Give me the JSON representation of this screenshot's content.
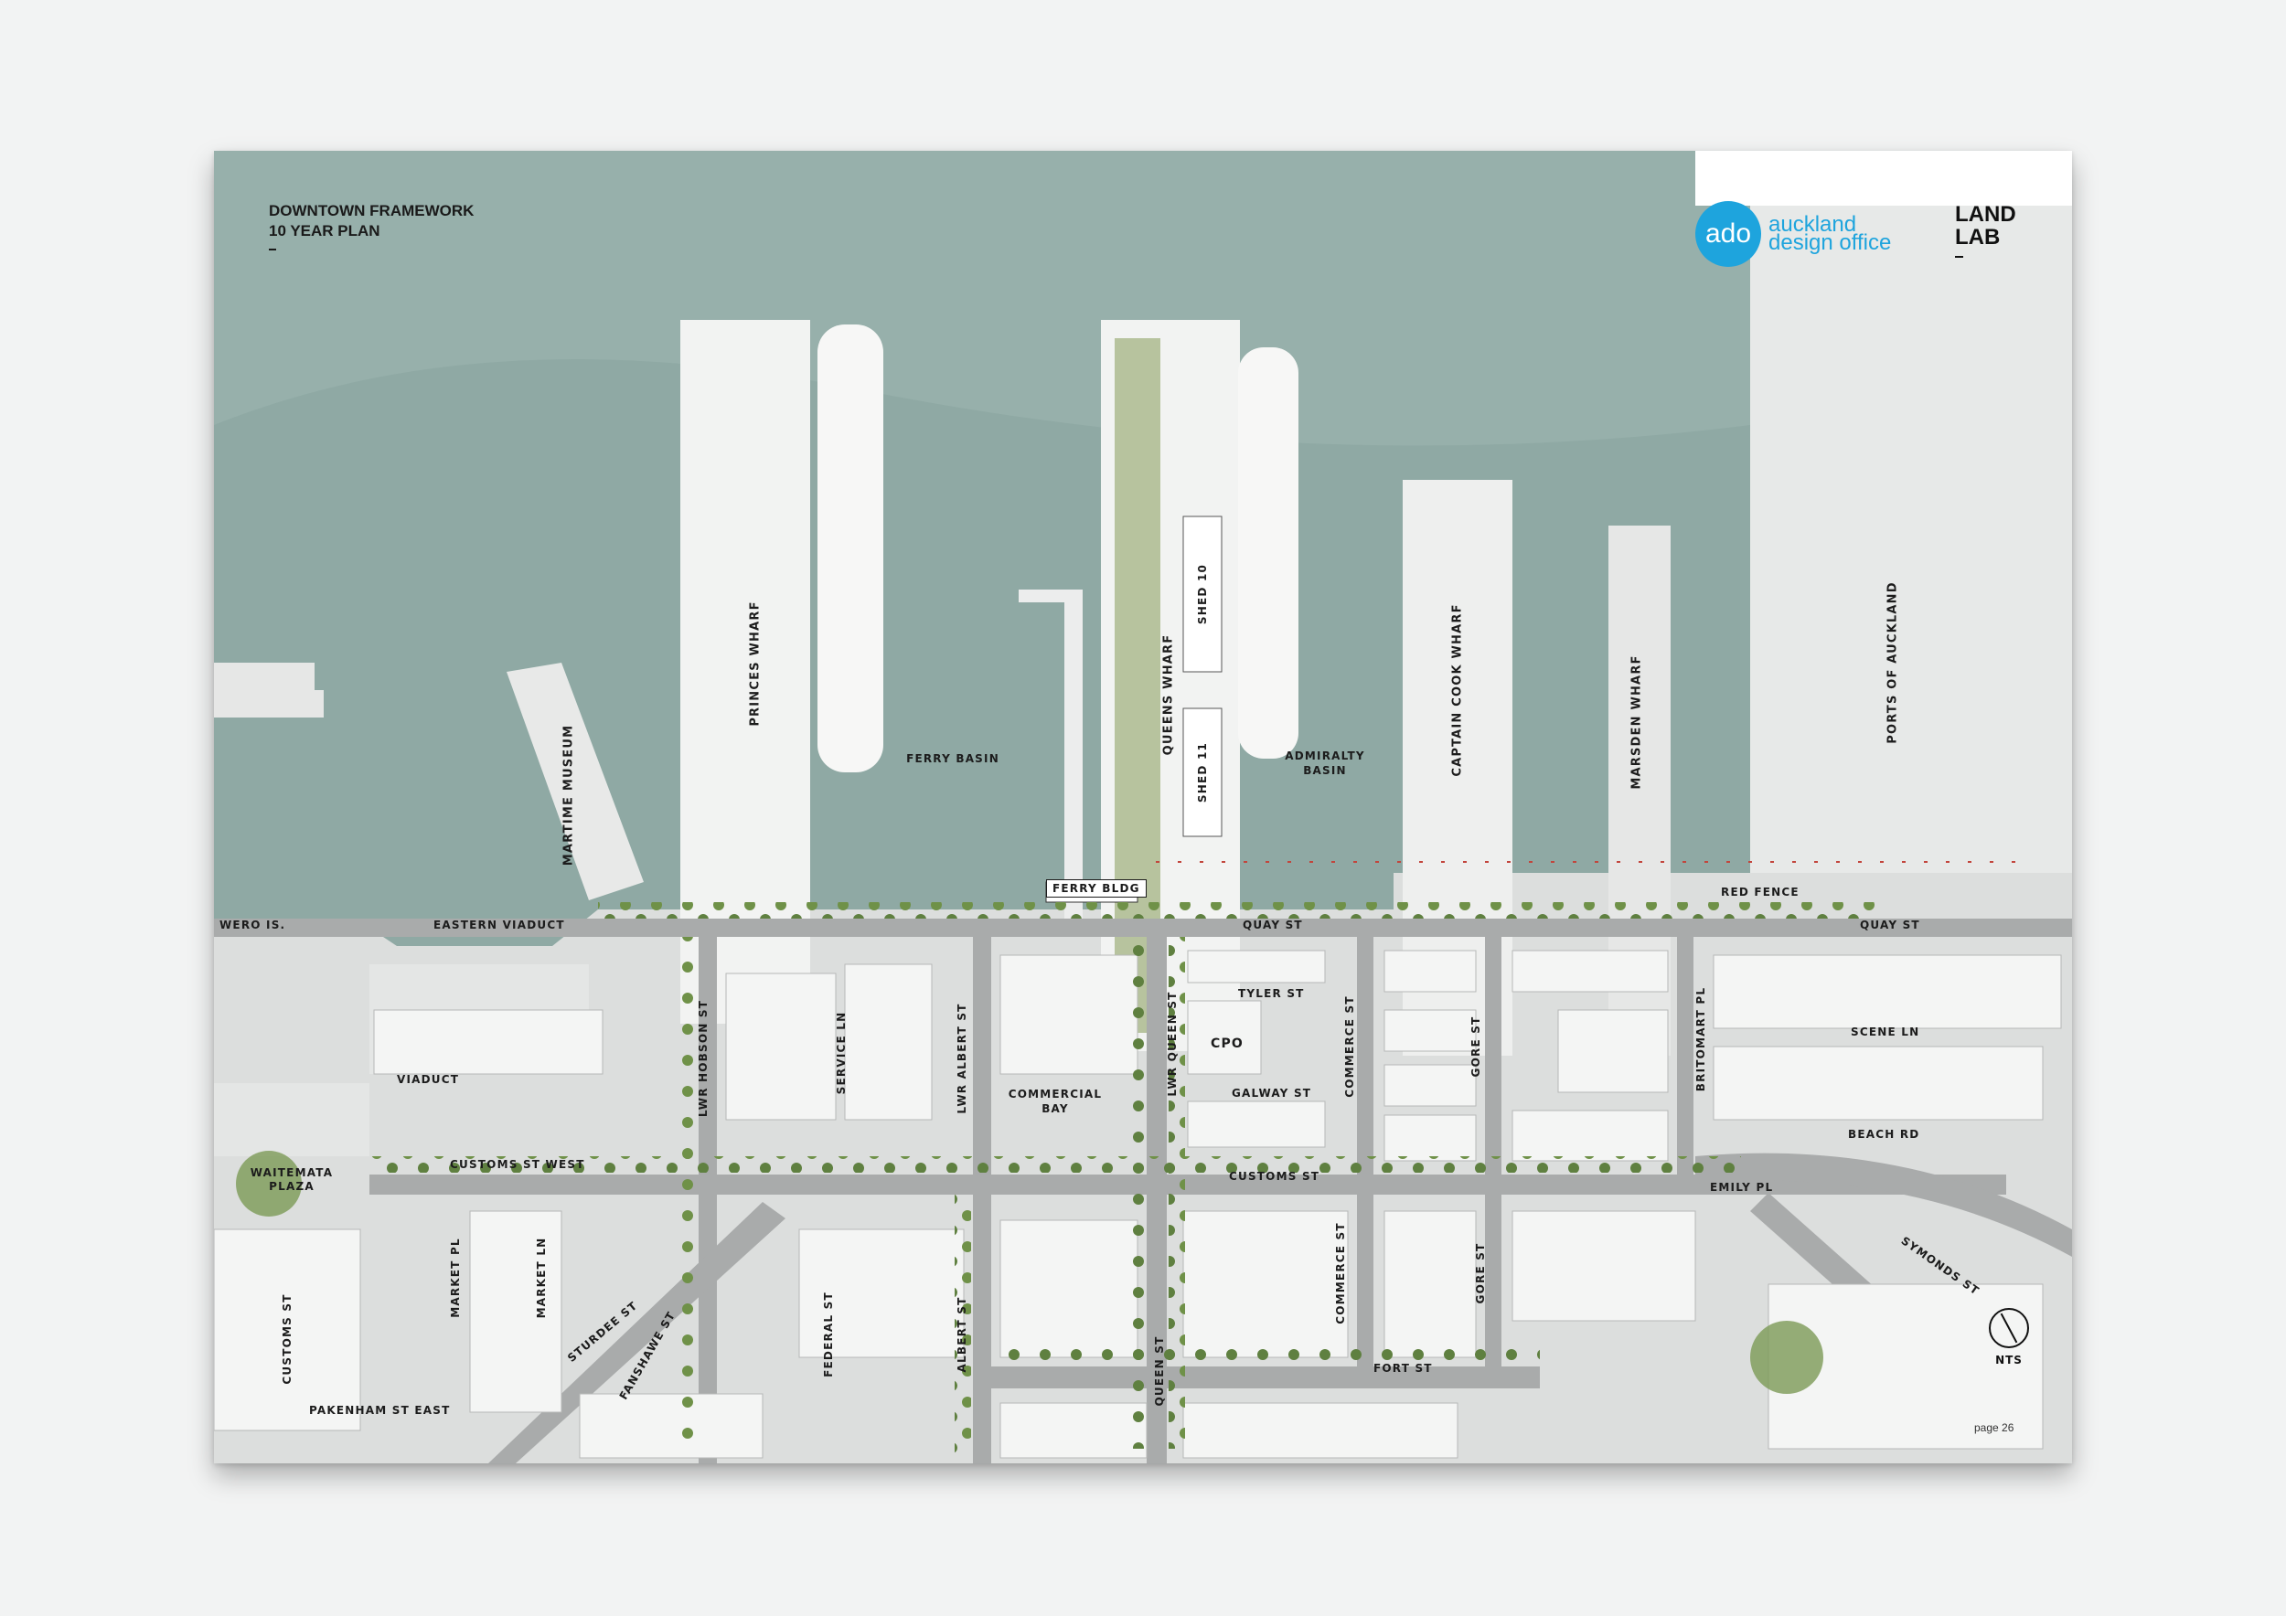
{
  "title": {
    "line1": "DOWNTOWN FRAMEWORK",
    "line2": "10 YEAR PLAN"
  },
  "logos": {
    "ado": {
      "mark": "ado",
      "line1": "auckland",
      "line2": "design office",
      "color": "#1ea4dd"
    },
    "landlab": {
      "line1": "LAND",
      "line2": "LAB"
    }
  },
  "page": "page  26",
  "north": {
    "label": "NTS",
    "icon": "north-arrow-icon"
  },
  "colors": {
    "water": "#8fa9a4",
    "land": "#dcdedd",
    "road": "#a9abab",
    "trees": "#6e8f4a",
    "wharf": "#f4f5f4"
  },
  "labels": {
    "princes_wharf": "PRINCES WHARF",
    "queens_wharf": "QUEENS WHARF",
    "captain_cook_wharf": "CAPTAIN COOK WHARF",
    "marsden_wharf": "MARSDEN WHARF",
    "ports_of_auckland": "PORTS OF AUCKLAND",
    "maritime_museum": "MARTIME MUSEUM",
    "shed_10": "SHED 10",
    "shed_11": "SHED 11",
    "ferry_basin": "FERRY BASIN",
    "admiralty_basin": "ADMIRALTY BASIN",
    "ferry_bldg": "FERRY BLDG",
    "red_fence": "RED FENCE",
    "wero_is": "WERO IS.",
    "eastern_viaduct": "EASTERN VIADUCT",
    "quay_st_1": "QUAY ST",
    "quay_st_2": "QUAY ST",
    "tyler_st": "TYLER ST",
    "cpo": "CPO",
    "galway_st": "GALWAY ST",
    "scene_ln": "SCENE LN",
    "beach_rd": "BEACH RD",
    "customs_st": "CUSTOMS ST",
    "customs_st_west": "CUSTOMS ST WEST",
    "emily_pl": "EMILY PL",
    "viaduct": "VIADUCT",
    "waitemata_plaza": "WAITEMATA PLAZA",
    "commercial_bay": "COMMERCIAL BAY",
    "lwr_hobson_st": "LWR HOBSON ST",
    "service_ln": "SERVICE LN",
    "lwr_albert_st": "LWR ALBERT ST",
    "lwr_queen_st": "LWR QUEEN ST",
    "commerce_st_1": "COMMERCE ST",
    "gore_st_1": "GORE ST",
    "britomart_pl": "BRITOMART PL",
    "customs_st_v": "CUSTOMS ST",
    "market_pl": "MARKET PL",
    "market_ln": "MARKET LN",
    "sturdee_st": "STURDEE ST",
    "fanshawe_st": "FANSHAWE ST",
    "federal_st": "FEDERAL ST",
    "albert_st": "ALBERT ST",
    "queen_st": "QUEEN ST",
    "commerce_st_2": "COMMERCE ST",
    "gore_st_2": "GORE ST",
    "fort_st": "FORT ST",
    "symonds_st": "SYMONDS ST",
    "pakenham_st_east": "PAKENHAM ST EAST"
  }
}
